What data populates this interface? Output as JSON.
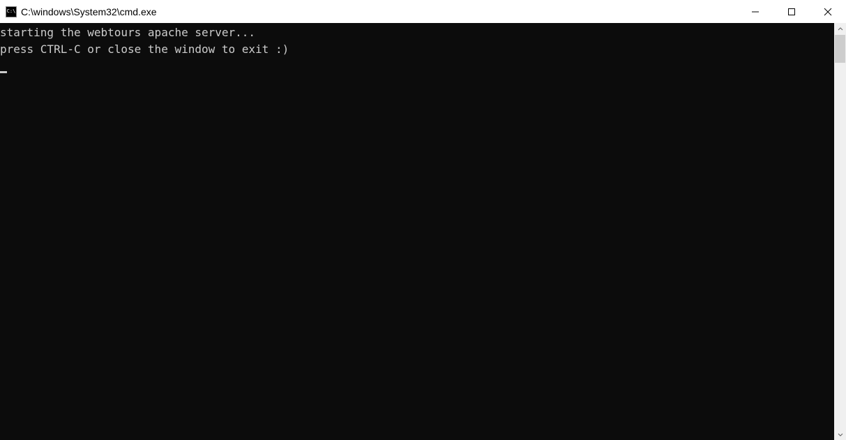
{
  "window": {
    "title": "C:\\windows\\System32\\cmd.exe",
    "icon_label": "C:\\"
  },
  "terminal": {
    "line1": "starting the webtours apache server...",
    "line2": "press CTRL-C or close the window to exit :)"
  }
}
